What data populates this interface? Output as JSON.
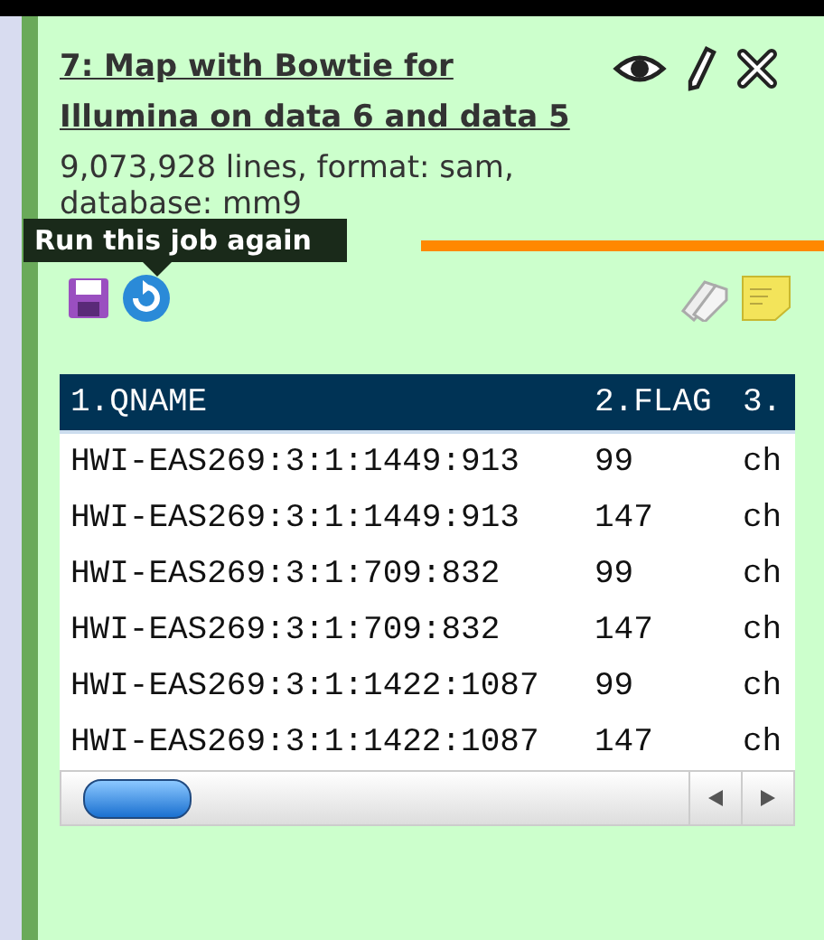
{
  "dataset": {
    "title": "7: Map with Bowtie for Illumina on data 6 and data 5",
    "summary": "9,073,928 lines, format: sam,",
    "database": "database: mm9",
    "tooltip": "Run this job again"
  },
  "table": {
    "columns": [
      "1.QNAME",
      "2.FLAG",
      "3."
    ],
    "rows": [
      [
        "HWI-EAS269:3:1:1449:913",
        "99",
        "ch"
      ],
      [
        "HWI-EAS269:3:1:1449:913",
        "147",
        "ch"
      ],
      [
        "HWI-EAS269:3:1:709:832",
        "99",
        "ch"
      ],
      [
        "HWI-EAS269:3:1:709:832",
        "147",
        "ch"
      ],
      [
        "HWI-EAS269:3:1:1422:1087",
        "99",
        "ch"
      ],
      [
        "HWI-EAS269:3:1:1422:1087",
        "147",
        "ch"
      ]
    ]
  }
}
